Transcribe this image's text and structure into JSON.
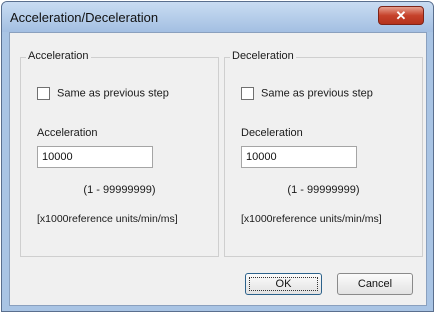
{
  "window": {
    "title": "Acceleration/Deceleration",
    "close_glyph": "✕",
    "close_icon": "close-icon"
  },
  "acceleration": {
    "group_label": "Acceleration",
    "checkbox_label": "Same as previous step",
    "checkbox_checked": false,
    "field_label": "Acceleration",
    "value": "10000",
    "range": "(1 - 99999999)",
    "units": "[x1000reference units/min/ms]"
  },
  "deceleration": {
    "group_label": "Deceleration",
    "checkbox_label": "Same as previous step",
    "checkbox_checked": false,
    "field_label": "Deceleration",
    "value": "10000",
    "range": "(1 - 99999999)",
    "units": "[x1000reference units/min/ms]"
  },
  "buttons": {
    "ok_label": "OK",
    "cancel_label": "Cancel"
  },
  "colors": {
    "titlebar": "#a9c4e4",
    "close_button": "#c6422b",
    "dialog_background": "#f0f0f0"
  }
}
